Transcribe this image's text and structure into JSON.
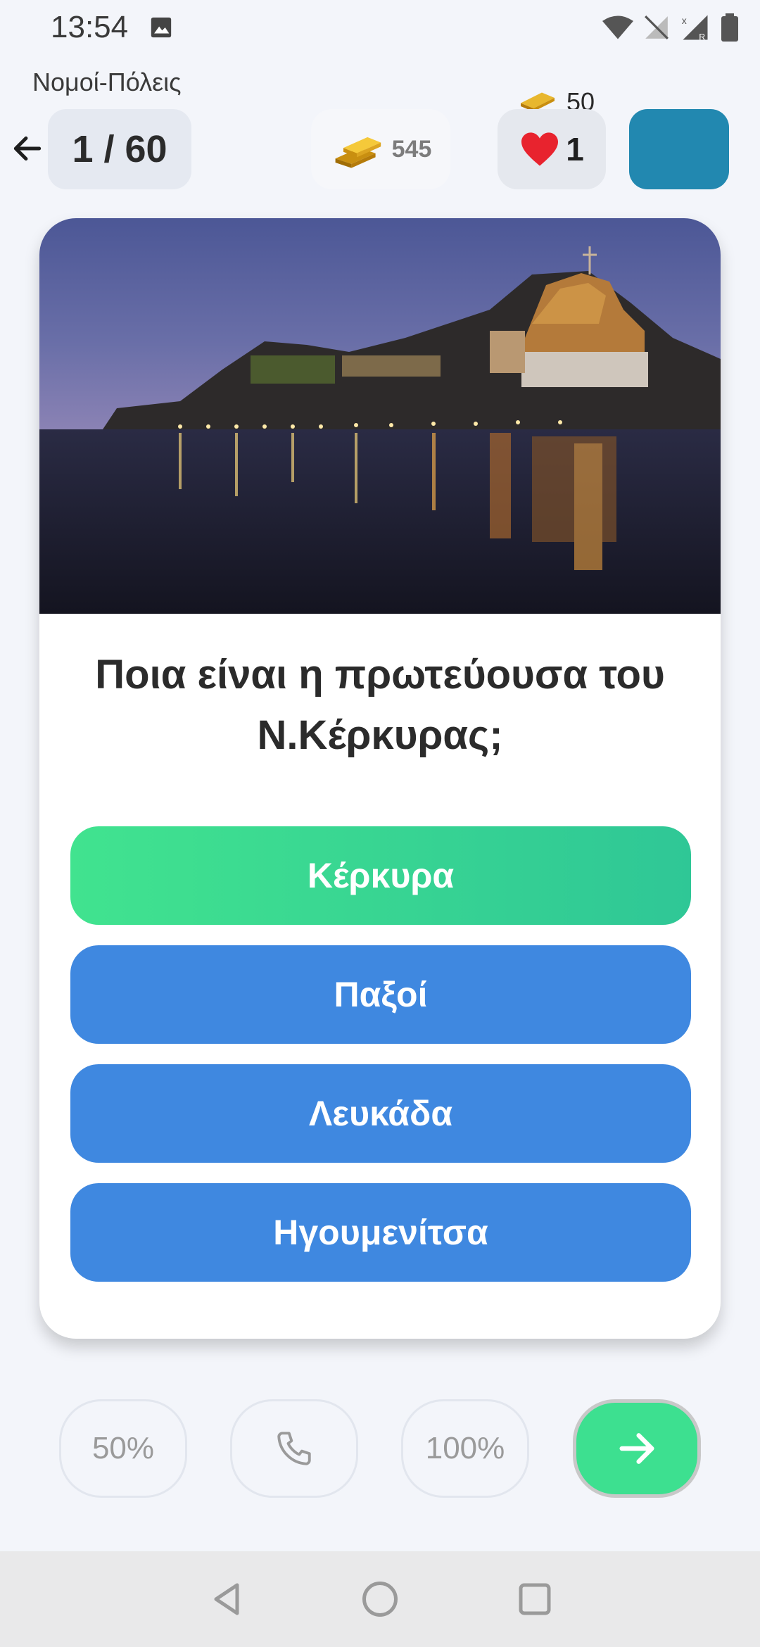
{
  "status_bar": {
    "time": "13:54",
    "icons": [
      "image-icon",
      "wifi-icon",
      "no-signal-icon",
      "signal-roaming-icon",
      "battery-icon"
    ]
  },
  "header": {
    "category": "Νομοί-Πόλεις",
    "progress": "1 / 60",
    "coins": "545",
    "bonus_coins": "50",
    "lives": "1",
    "profile_color": "#2288b0"
  },
  "question": {
    "image_alt": "Corfu old fortress at night reflected in water",
    "text": "Ποια είναι η πρωτεύουσα του Ν.Κέρκυρας;",
    "answers": [
      {
        "label": "Κέρκυρα",
        "state": "correct"
      },
      {
        "label": "Παξοί",
        "state": "normal"
      },
      {
        "label": "Λευκάδα",
        "state": "normal"
      },
      {
        "label": "Ηγουμενίτσα",
        "state": "normal"
      }
    ]
  },
  "lifelines": {
    "fifty": "50%",
    "phone_icon": "phone-icon",
    "hundred": "100%",
    "next_icon": "arrow-right-icon"
  },
  "colors": {
    "accent_green": "#3de090",
    "answer_blue": "#3f88e0",
    "background": "#f3f5fa"
  }
}
